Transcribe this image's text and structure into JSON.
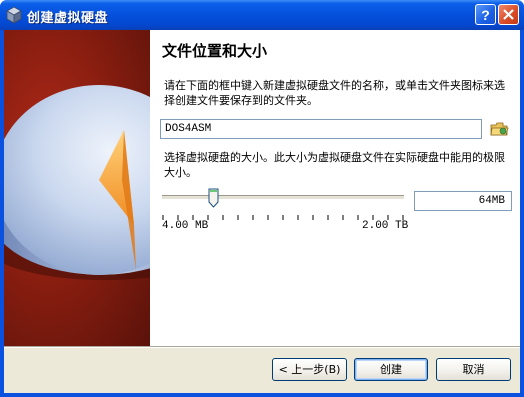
{
  "window": {
    "title": "创建虚拟硬盘",
    "app_icon": "virtualbox-cube-icon",
    "help_icon": "help-icon",
    "close_icon": "close-icon",
    "titlebar_color": "#0550dc"
  },
  "content": {
    "heading": "文件位置和大小",
    "location_description": "请在下面的框中键入新建虚拟硬盘文件的名称，或单击文件夹图标来选择创建文件要保存到的文件夹。",
    "file_name": "DOS4ASM",
    "folder_icon": "folder-icon",
    "size_description": "选择虚拟硬盘的大小。此大小为虚拟硬盘文件在实际硬盘中能用的极限大小。",
    "size_value": "64MB",
    "slider_min_label": "4.00 MB",
    "slider_max_label": "2.00 TB"
  },
  "buttons": {
    "back": "< 上一步(B)",
    "create": "创建",
    "cancel": "取消"
  }
}
